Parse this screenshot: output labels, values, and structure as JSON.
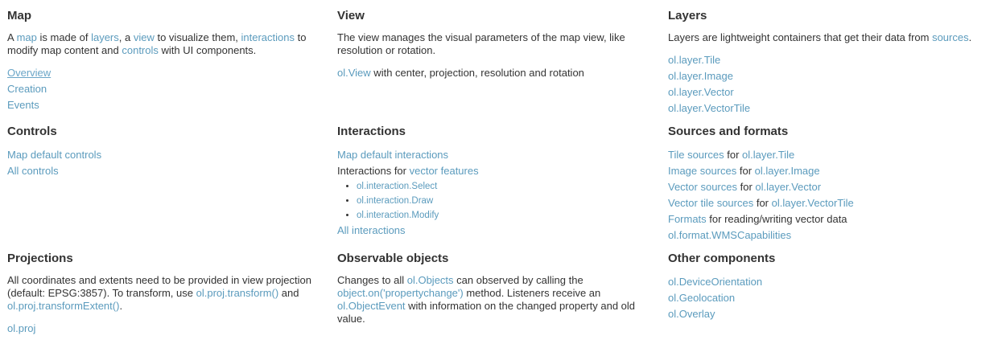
{
  "map": {
    "title": "Map",
    "desc": {
      "t1": "A ",
      "l1": "map",
      "t2": " is made of ",
      "l2": "layers",
      "t3": ", a ",
      "l3": "view",
      "t4": " to visualize them, ",
      "l4": "interactions",
      "t5": " to modify map content and ",
      "l5": "controls",
      "t6": " with UI components."
    },
    "links": [
      "Overview",
      "Creation",
      "Events"
    ]
  },
  "view": {
    "title": "View",
    "desc": "The view manages the visual parameters of the map view, like resolution or rotation.",
    "item_link": "ol.View",
    "item_text": " with center, projection, resolution and rotation"
  },
  "layers": {
    "title": "Layers",
    "desc_text": "Layers are lightweight containers that get their data from ",
    "desc_link": "sources",
    "desc_end": ".",
    "links": [
      "ol.layer.Tile",
      "ol.layer.Image",
      "ol.layer.Vector",
      "ol.layer.VectorTile"
    ]
  },
  "controls": {
    "title": "Controls",
    "links": [
      "Map default controls",
      "All controls"
    ]
  },
  "interactions": {
    "title": "Interactions",
    "default_link": "Map default interactions",
    "for_text": "Interactions for ",
    "for_link": "vector features",
    "bullets": [
      "ol.interaction.Select",
      "ol.interaction.Draw",
      "ol.interaction.Modify"
    ],
    "all_link": "All interactions"
  },
  "sources": {
    "title": "Sources and formats",
    "rows": [
      {
        "link": "Tile sources",
        "text": " for ",
        "link2": "ol.layer.Tile"
      },
      {
        "link": "Image sources",
        "text": " for ",
        "link2": "ol.layer.Image"
      },
      {
        "link": "Vector sources",
        "text": " for ",
        "link2": "ol.layer.Vector"
      },
      {
        "link": "Vector tile sources",
        "text": " for ",
        "link2": "ol.layer.VectorTile"
      }
    ],
    "formats_link": "Formats",
    "formats_text": " for reading/writing vector data",
    "wms_link": "ol.format.WMSCapabilities"
  },
  "projections": {
    "title": "Projections",
    "t1": "All coordinates and extents need to be provided in view projection (default: EPSG:3857). To transform, use ",
    "l1": "ol.proj.transform()",
    "t2": " and ",
    "l2": "ol.proj.transformExtent()",
    "t3": ".",
    "link": "ol.proj"
  },
  "observable": {
    "title": "Observable objects",
    "t1": "Changes to all ",
    "l1": "ol.Objects",
    "t2": " can observed by calling the ",
    "l2": "object.on('propertychange')",
    "t3": " method. Listeners receive an ",
    "l3": "ol.ObjectEvent",
    "t4": " with information on the changed property and old value."
  },
  "other": {
    "title": "Other components",
    "links": [
      "ol.DeviceOrientation",
      "ol.Geolocation",
      "ol.Overlay"
    ]
  }
}
